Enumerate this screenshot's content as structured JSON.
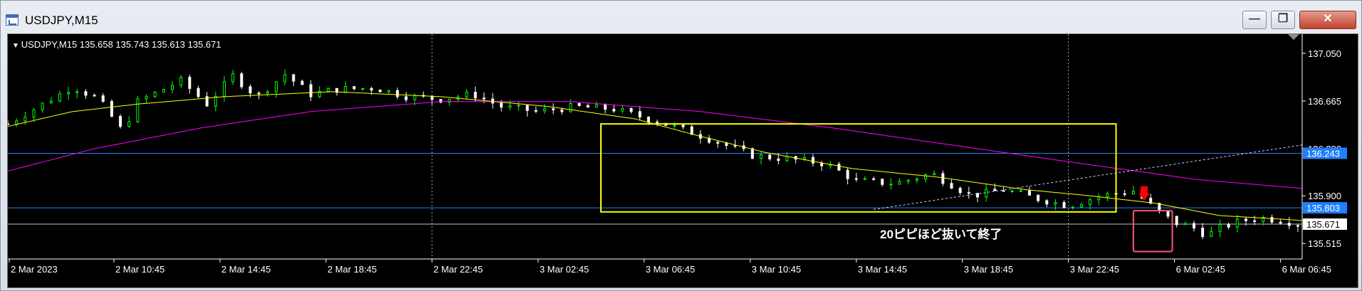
{
  "window": {
    "title": "USDJPY,M15",
    "buttons": {
      "minimize": "—",
      "maximize": "❐",
      "close": "✕"
    }
  },
  "chart_header": {
    "label": "USDJPY,M15  135.658 135.743 135.613 135.671"
  },
  "annotation": {
    "text": "20ピピほど抜いて終了"
  },
  "price_labels": {
    "upper_blue_line": "136.243",
    "lower_blue_line": "135.803",
    "current_price": "135.671"
  },
  "colors": {
    "background": "#000000",
    "bull_candle": "#00ff00",
    "bear_candle": "#ffffff",
    "ma_fast": "#ffff00",
    "ma_slow": "#ff00ff",
    "horizontal_lines": "#1e7fff",
    "range_box": "#ffff00",
    "exit_box": "#ff5577",
    "sell_arrow": "#ff0000",
    "trendline": "#c9d6ff"
  },
  "chart_data": {
    "type": "candlestick",
    "symbol": "USDJPY",
    "timeframe": "M15",
    "x_tick_labels": [
      "2 Mar 2023",
      "2 Mar 10:45",
      "2 Mar 14:45",
      "2 Mar 18:45",
      "2 Mar 22:45",
      "3 Mar 02:45",
      "3 Mar 06:45",
      "3 Mar 10:45",
      "3 Mar 14:45",
      "3 Mar 18:45",
      "3 Mar 22:45",
      "6 Mar 02:45",
      "6 Mar 06:45"
    ],
    "y_tick_labels": [
      "137.050",
      "136.665",
      "136.280",
      "135.900",
      "135.515"
    ],
    "ylim": [
      135.39,
      137.17
    ],
    "horizontal_lines": [
      136.243,
      135.803,
      135.671
    ],
    "session_separators": [
      "2 Mar 22:45",
      "3 Mar 22:45"
    ],
    "close_path": [
      [
        0,
        136.48
      ],
      [
        14,
        136.62
      ],
      [
        30,
        136.78
      ],
      [
        42,
        136.68
      ],
      [
        53,
        136.42
      ],
      [
        60,
        136.66
      ],
      [
        80,
        136.83
      ],
      [
        92,
        136.64
      ],
      [
        104,
        136.87
      ],
      [
        115,
        136.7
      ],
      [
        128,
        136.88
      ],
      [
        140,
        136.72
      ],
      [
        152,
        136.76
      ],
      [
        170,
        136.77
      ],
      [
        185,
        136.7
      ],
      [
        200,
        136.68
      ],
      [
        215,
        136.72
      ],
      [
        228,
        136.62
      ],
      [
        245,
        136.58
      ],
      [
        262,
        136.62
      ],
      [
        280,
        136.6
      ],
      [
        300,
        136.5
      ],
      [
        318,
        136.4
      ],
      [
        330,
        136.32
      ],
      [
        345,
        136.22
      ],
      [
        360,
        136.2
      ],
      [
        378,
        136.16
      ],
      [
        392,
        136.02
      ],
      [
        410,
        136.0
      ],
      [
        427,
        136.08
      ],
      [
        445,
        135.9
      ],
      [
        460,
        135.95
      ],
      [
        475,
        135.88
      ],
      [
        490,
        135.82
      ],
      [
        505,
        135.9
      ],
      [
        520,
        135.94
      ],
      [
        533,
        135.75
      ],
      [
        540,
        135.68
      ],
      [
        547,
        135.65
      ],
      [
        554,
        135.58
      ],
      [
        560,
        135.64
      ],
      [
        570,
        135.7
      ],
      [
        580,
        135.72
      ],
      [
        590,
        135.7
      ],
      [
        598,
        135.66
      ]
    ],
    "ma_fast_path": [
      [
        0,
        136.46
      ],
      [
        30,
        136.58
      ],
      [
        60,
        136.64
      ],
      [
        100,
        136.7
      ],
      [
        150,
        136.74
      ],
      [
        200,
        136.7
      ],
      [
        250,
        136.62
      ],
      [
        290,
        136.52
      ],
      [
        320,
        136.38
      ],
      [
        350,
        136.25
      ],
      [
        390,
        136.12
      ],
      [
        430,
        136.05
      ],
      [
        470,
        135.95
      ],
      [
        500,
        135.9
      ],
      [
        530,
        135.84
      ],
      [
        560,
        135.74
      ],
      [
        590,
        135.71
      ],
      [
        598,
        135.7
      ]
    ],
    "ma_slow_path": [
      [
        0,
        136.1
      ],
      [
        40,
        136.28
      ],
      [
        90,
        136.45
      ],
      [
        140,
        136.58
      ],
      [
        200,
        136.66
      ],
      [
        260,
        136.66
      ],
      [
        320,
        136.58
      ],
      [
        380,
        136.45
      ],
      [
        440,
        136.3
      ],
      [
        500,
        136.15
      ],
      [
        550,
        136.03
      ],
      [
        598,
        135.96
      ]
    ],
    "range_box": {
      "x": [
        274,
        512
      ],
      "y": [
        135.77,
        136.48
      ]
    },
    "exit_box": {
      "x": [
        520,
        538
      ],
      "y": [
        135.45,
        135.78
      ]
    },
    "trendline": {
      "x": [
        400,
        598
      ],
      "y": [
        135.79,
        136.31
      ]
    },
    "sell_signal": {
      "x": 525,
      "y": 135.92
    }
  }
}
